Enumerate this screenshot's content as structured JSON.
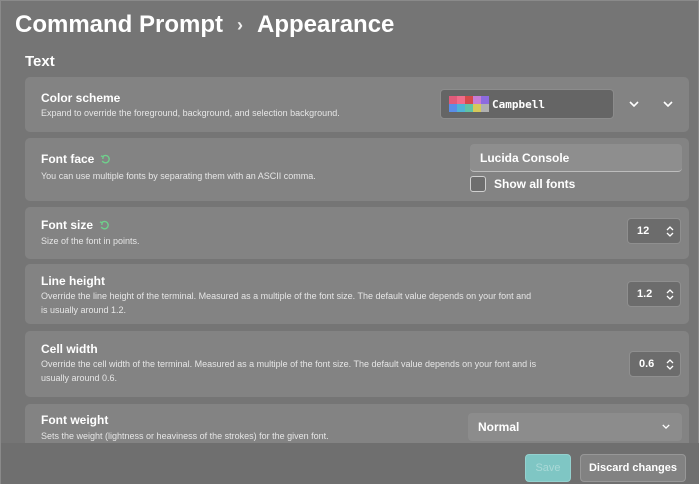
{
  "breadcrumb": {
    "parent": "Command Prompt",
    "separator": "›",
    "current": "Appearance"
  },
  "section": {
    "title": "Text"
  },
  "settings": {
    "color_scheme": {
      "title": "Color scheme",
      "description": "Expand to override the foreground, background, and selection background.",
      "value": "Campbell",
      "swatch_colors": [
        "#e15b7a",
        "#f06c8a",
        "#d44a4a",
        "#c77dd6",
        "#8d6be0",
        "#5a8de8",
        "#4fb3d6",
        "#5fc3a6",
        "#d6c85a",
        "#b0b0b0"
      ]
    },
    "font_face": {
      "title": "Font face",
      "description": "You can use multiple fonts by separating them with an ASCII comma.",
      "value": "Lucida Console",
      "checkbox_label": "Show all fonts"
    },
    "font_size": {
      "title": "Font size",
      "description": "Size of the font in points.",
      "value": "12"
    },
    "line_height": {
      "title": "Line height",
      "description_line1": "Override the line height of the terminal. Measured as a multiple of the font size. The default value depends on your font and",
      "description_line2": "is usually around 1.2.",
      "value": "1.2"
    },
    "cell_width": {
      "title": "Cell width",
      "description_line1": "Override the cell width of the terminal. Measured as a multiple of the font size. The default value depends on your font and is",
      "description_line2": "usually around 0.6.",
      "value": "0.6"
    },
    "font_weight": {
      "title": "Font weight",
      "description": "Sets the weight (lightness or heaviness of the strokes) for the given font.",
      "value": "Normal"
    }
  },
  "footer": {
    "save_label": "Save",
    "discard_label": "Discard changes"
  },
  "colors": {
    "accent": "#7fc6c4",
    "reset_icon": "#6fd08c"
  }
}
